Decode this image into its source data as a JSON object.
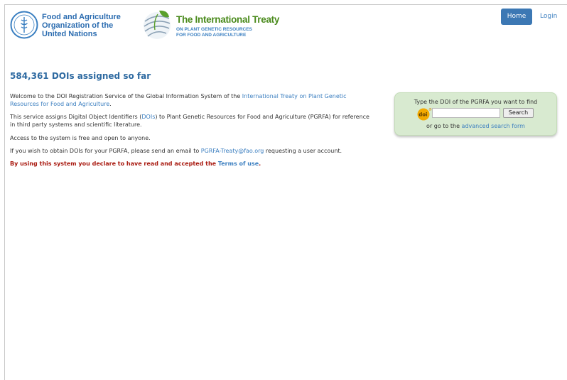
{
  "header": {
    "fao_name": [
      "Food and Agriculture",
      "Organization of the",
      "United Nations"
    ],
    "fao_logo_text": "FAO",
    "treaty_title": "The International Treaty",
    "treaty_subtitle": [
      "ON PLANT GENETIC RESOURCES",
      "FOR FOOD AND AGRICULTURE"
    ],
    "nav": {
      "home": "Home",
      "login": "Login"
    }
  },
  "main": {
    "heading": "584,361 DOIs assigned so far",
    "p1_before": "Welcome to the DOI Registration Service of the Global Information System of the ",
    "p1_link": "International Treaty on Plant Genetic Resources for Food and Agriculture",
    "p1_after": ".",
    "p2_before": "This service assigns Digital Object Identifiers (",
    "p2_link": "DOIs",
    "p2_after": ") to Plant Genetic Resources for Food and Agriculture (PGRFA) for reference in third party systems and scientific literature.",
    "p3": "Access to the system is free and open to anyone.",
    "p4_before": "If you wish to obtain DOIs for your PGRFA, please send an email to ",
    "p4_link": "PGRFA-Treaty@fao.org",
    "p4_after": " requesting a user account.",
    "p5_before": "By using this system you declare to have read and accepted the ",
    "p5_link": "Terms of use",
    "p5_after": "."
  },
  "search": {
    "prompt": "Type the DOI of the PGRFA you want to find",
    "badge": "doi",
    "input_value": "",
    "button": "Search",
    "alt_before": "or go to the ",
    "alt_link": "advanced search form"
  },
  "colors": {
    "link": "#3c7fc0",
    "heading": "#2e6aa1",
    "warning": "#a8180e",
    "home_button": "#3c78b4",
    "search_panel": "#d8ead0"
  },
  "icons": [
    "fao-logo-icon",
    "treaty-logo-icon",
    "doi-badge-icon"
  ]
}
